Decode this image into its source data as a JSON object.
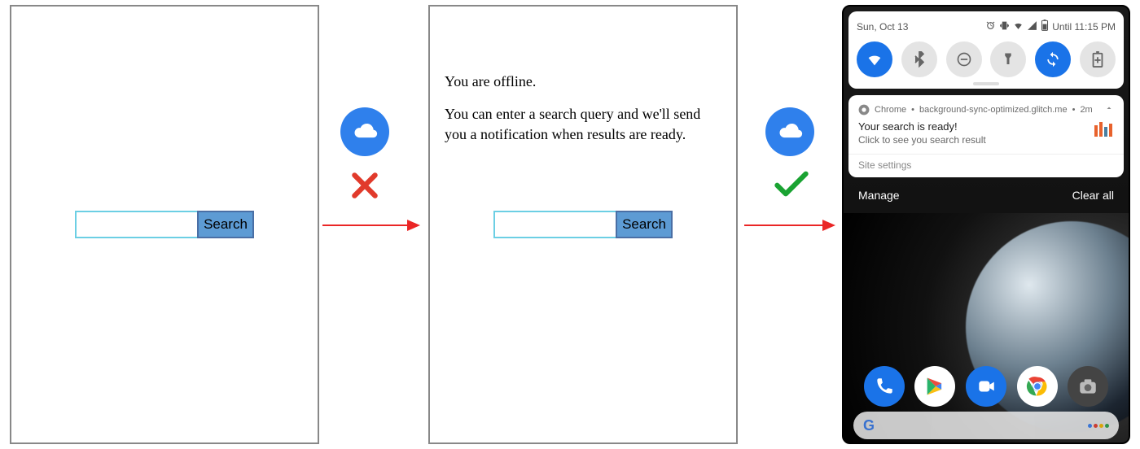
{
  "panel1": {
    "search_placeholder": "",
    "search_button": "Search"
  },
  "transition1": {
    "online": false
  },
  "panel2": {
    "offline_heading": "You are offline.",
    "offline_text": "You can enter a search query and we'll send you a notification when results are ready.",
    "search_placeholder": "",
    "search_button": "Search"
  },
  "transition2": {
    "online": true
  },
  "phone": {
    "statusbar": {
      "date": "Sun, Oct 13",
      "right_text": "Until 11:15 PM"
    },
    "quick_settings": [
      {
        "name": "wifi",
        "active": true
      },
      {
        "name": "bluetooth",
        "active": false
      },
      {
        "name": "dnd",
        "active": false
      },
      {
        "name": "flashlight",
        "active": false
      },
      {
        "name": "rotate",
        "active": true
      },
      {
        "name": "battery-saver",
        "active": false
      }
    ],
    "notification": {
      "app": "Chrome",
      "source": "background-sync-optimized.glitch.me",
      "age": "2m",
      "title": "Your search is ready!",
      "text": "Click to see you search result",
      "settings_label": "Site settings"
    },
    "shade_actions": {
      "manage": "Manage",
      "clear_all": "Clear all"
    },
    "dock": [
      "phone",
      "play",
      "duo",
      "chrome",
      "camera"
    ],
    "google_search": {
      "logo": "Google"
    }
  }
}
